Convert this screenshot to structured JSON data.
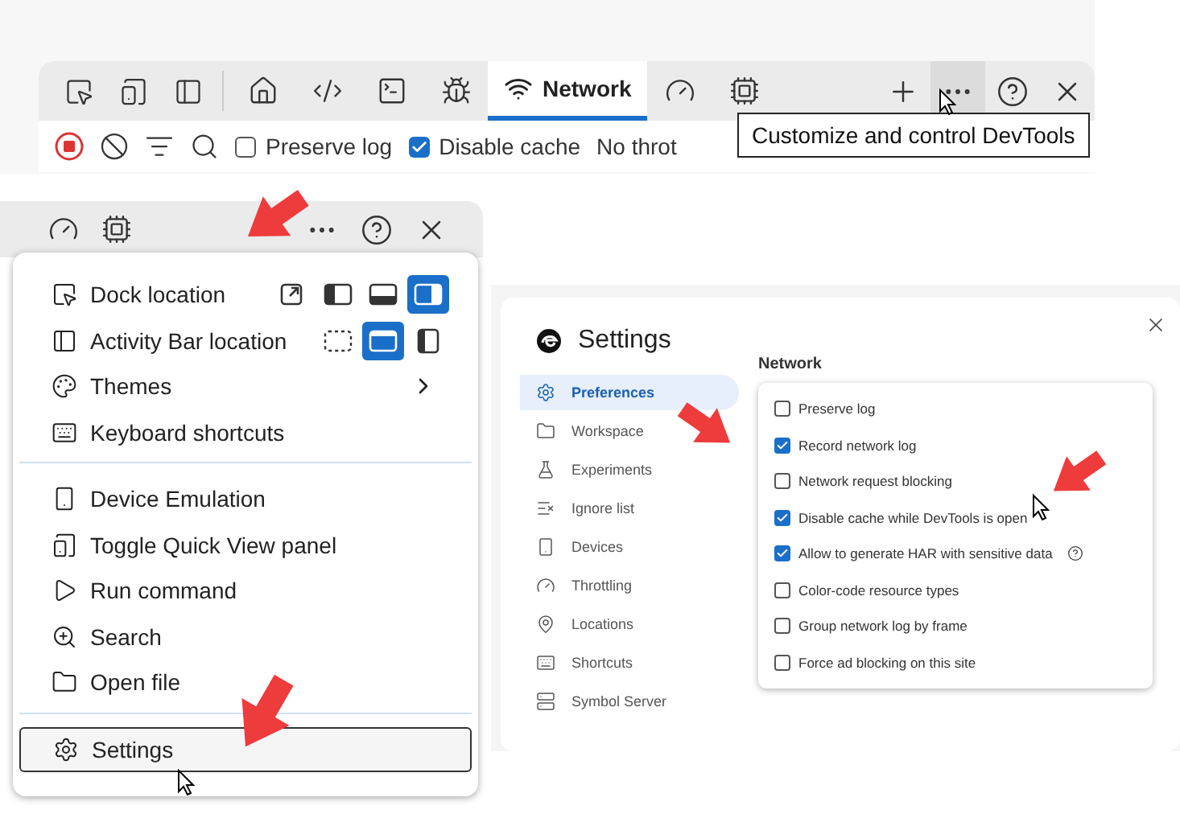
{
  "toolbar": {
    "tabs": [
      {
        "selected": false
      },
      {
        "selected": false
      },
      {
        "selected": false
      },
      {
        "selected": false
      },
      {
        "label": "Network",
        "selected": true
      },
      {
        "selected": false
      },
      {
        "selected": false
      }
    ]
  },
  "filter_bar": {
    "preserve_log": {
      "label": "Preserve log",
      "checked": false
    },
    "disable_cache": {
      "label": "Disable cache",
      "checked": true
    },
    "throttling": "No throt"
  },
  "tooltip": "Customize and control DevTools",
  "menu": {
    "sections": [
      [
        {
          "kind": "options",
          "label": "Dock location",
          "focused": false,
          "options": [
            {
              "selected": false
            },
            {
              "selected": false
            },
            {
              "selected": false
            },
            {
              "selected": true
            }
          ]
        },
        {
          "kind": "options",
          "label": "Activity Bar location",
          "focused": false,
          "options": [
            {
              "selected": false
            },
            {
              "selected": true
            },
            {
              "selected": false
            }
          ]
        },
        {
          "kind": "submenu",
          "label": "Themes",
          "focused": false
        },
        {
          "kind": "action",
          "label": "Keyboard shortcuts",
          "focused": false
        }
      ],
      [
        {
          "kind": "action",
          "label": "Device Emulation",
          "focused": false
        },
        {
          "kind": "action",
          "label": "Toggle Quick View panel",
          "focused": false
        },
        {
          "kind": "action",
          "label": "Run command",
          "focused": false
        },
        {
          "kind": "action",
          "label": "Search",
          "focused": false
        },
        {
          "kind": "action",
          "label": "Open file",
          "focused": false
        }
      ],
      [
        {
          "kind": "action",
          "label": "Settings",
          "focused": true
        }
      ]
    ]
  },
  "settings": {
    "title": "Settings",
    "nav": [
      {
        "label": "Preferences",
        "selected": true
      },
      {
        "label": "Workspace",
        "selected": false
      },
      {
        "label": "Experiments",
        "selected": false
      },
      {
        "label": "Ignore list",
        "selected": false
      },
      {
        "label": "Devices",
        "selected": false
      },
      {
        "label": "Throttling",
        "selected": false
      },
      {
        "label": "Locations",
        "selected": false
      },
      {
        "label": "Shortcuts",
        "selected": false
      },
      {
        "label": "Symbol Server",
        "selected": false
      }
    ],
    "section_title": "Network",
    "options": [
      {
        "label": "Preserve log",
        "checked": false,
        "help": false
      },
      {
        "label": "Record network log",
        "checked": true,
        "help": false
      },
      {
        "label": "Network request blocking",
        "checked": false,
        "help": false
      },
      {
        "label": "Disable cache while DevTools is open",
        "checked": true,
        "help": false
      },
      {
        "label": "Allow to generate HAR with sensitive data",
        "checked": true,
        "help": true
      },
      {
        "label": "Color-code resource types",
        "checked": false,
        "help": false
      },
      {
        "label": "Group network log by frame",
        "checked": false,
        "help": false
      },
      {
        "label": "Force ad blocking on this site",
        "checked": false,
        "help": false
      }
    ]
  }
}
